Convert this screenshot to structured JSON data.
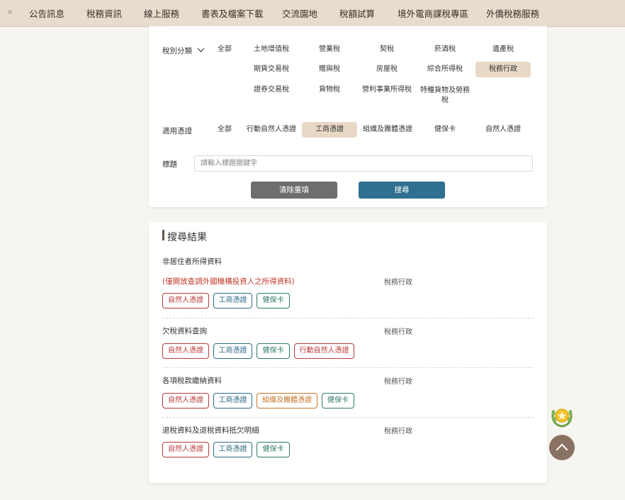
{
  "nav": {
    "menu_icon": "menu-icon",
    "items": [
      "公告訊息",
      "稅務資訊",
      "線上服務",
      "書表及檔案下載",
      "交流園地",
      "稅額試算",
      "境外電商課稅專區",
      "外僑稅務服務"
    ]
  },
  "filters": {
    "tax_category_label": "稅別分類",
    "tax_categories": [
      "全部",
      "土地增值稅",
      "營業稅",
      "契稅",
      "菸酒稅",
      "遺產稅",
      "期貨交易稅",
      "贈與稅",
      "房屋稅",
      "綜合所得稅",
      "稅務行政",
      "證券交易稅",
      "貨物稅",
      "營利事業所得稅",
      "特種貨物及勞務稅"
    ],
    "tax_category_selected": "稅務行政",
    "certificate_label": "適用憑證",
    "certificates": [
      "全部",
      "行動自然人憑證",
      "工商憑證",
      "組織及團體憑證",
      "健保卡",
      "自然人憑證"
    ],
    "certificate_selected": "工商憑證",
    "title_label": "標題",
    "title_placeholder": "請輸入標題關鍵字",
    "title_value": "",
    "reset_label": "清除重填",
    "search_label": "搜尋"
  },
  "results": {
    "heading": "搜尋結果",
    "items": [
      {
        "title": "非居住者所得資料",
        "note": "(僅開放查調外國機構投資人之所得資料)",
        "category": "稅務行政",
        "tags": [
          "自然人憑證",
          "工商憑證",
          "健保卡"
        ]
      },
      {
        "title": "欠稅資料查詢",
        "category": "稅務行政",
        "tags": [
          "自然人憑證",
          "工商憑證",
          "健保卡",
          "行動自然人憑證"
        ]
      },
      {
        "title": "各項稅款繳納資料",
        "category": "稅務行政",
        "tags": [
          "自然人憑證",
          "工商憑證",
          "組織及團體憑證",
          "健保卡"
        ]
      },
      {
        "title": "退稅資料及退稅資料抵欠明細",
        "category": "稅務行政",
        "tags": [
          "自然人憑證",
          "工商憑證",
          "健保卡"
        ]
      }
    ]
  },
  "floating": {
    "award_icon": "award-icon",
    "to_top_icon": "chevron-up-icon"
  },
  "colors": {
    "nav_bg": "#e8dccd",
    "selected_bg": "#e8d9c6",
    "search_button": "#2f6f8f",
    "reset_button": "#6e6e6e",
    "tag_red": "#b83a3a",
    "tag_blue": "#2d6b85",
    "tag_teal": "#2f7a6a",
    "tag_orange": "#c8742a"
  }
}
